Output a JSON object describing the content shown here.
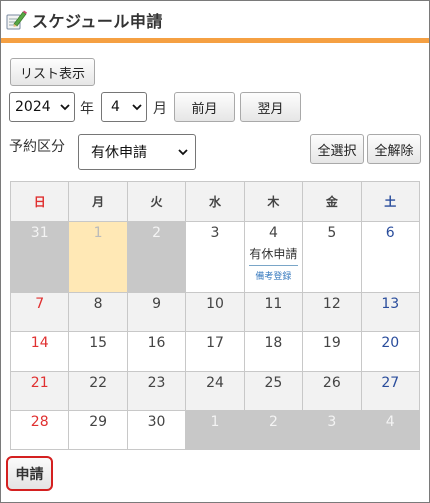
{
  "header": {
    "title": "スケジュール申請",
    "icon": "pencil-notepad-icon"
  },
  "toolbar": {
    "list_view_label": "リスト表示",
    "year_value": "2024",
    "year_suffix": "年",
    "month_value": "4",
    "month_suffix": "月",
    "prev_month_label": "前月",
    "next_month_label": "翌月",
    "reservation_type_label": "予約区分",
    "reservation_type_value": "有休申請",
    "select_all_label": "全選択",
    "clear_all_label": "全解除"
  },
  "calendar": {
    "weekdays": [
      "日",
      "月",
      "火",
      "水",
      "木",
      "金",
      "土"
    ],
    "weeks": [
      [
        "31",
        "1",
        "2",
        "3",
        "4",
        "5",
        "6"
      ],
      [
        "7",
        "8",
        "9",
        "10",
        "11",
        "12",
        "13"
      ],
      [
        "14",
        "15",
        "16",
        "17",
        "18",
        "19",
        "20"
      ],
      [
        "21",
        "22",
        "23",
        "24",
        "25",
        "26",
        "27"
      ],
      [
        "28",
        "29",
        "30",
        "1",
        "2",
        "3",
        "4"
      ]
    ],
    "entry": {
      "label": "有休申請",
      "link": "備考登録"
    }
  },
  "footer": {
    "apply_label": "申請"
  },
  "colors": {
    "accent_orange": "#f5a042",
    "sunday_red": "#e03030",
    "saturday_blue": "#2a4d9c",
    "out_of_month_gray": "#c8c8c8",
    "selected_day": "#ffe8b5",
    "apply_border_red": "#d42020"
  }
}
